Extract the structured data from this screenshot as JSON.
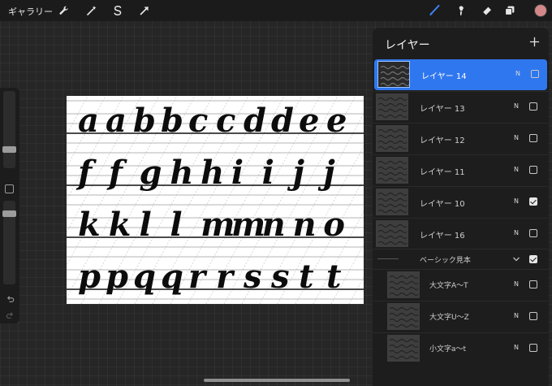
{
  "topbar": {
    "gallery_label": "ギャラリー",
    "tools": [
      {
        "name": "wrench-icon"
      },
      {
        "name": "magic-wand-icon"
      },
      {
        "name": "selection-s-icon"
      },
      {
        "name": "transform-arrow-icon"
      }
    ],
    "right_tools": [
      {
        "name": "brush-icon",
        "active": true
      },
      {
        "name": "smudge-icon"
      },
      {
        "name": "eraser-icon"
      },
      {
        "name": "layers-icon"
      }
    ],
    "active_color": "#d28888",
    "accent_color": "#2f77ee"
  },
  "canvas": {
    "rows": [
      "a a b b c c d d e e",
      "f f g h h i i j j",
      "k k l l m m n n o",
      "p p q q r r s s t t"
    ]
  },
  "layers": {
    "title": "レイヤー",
    "items": [
      {
        "name": "レイヤー 14",
        "blend": "N",
        "visible": false,
        "selected": true
      },
      {
        "name": "レイヤー 13",
        "blend": "N",
        "visible": false,
        "selected": false
      },
      {
        "name": "レイヤー 12",
        "blend": "N",
        "visible": false,
        "selected": false
      },
      {
        "name": "レイヤー 11",
        "blend": "N",
        "visible": false,
        "selected": false
      },
      {
        "name": "レイヤー 10",
        "blend": "N",
        "visible": true,
        "selected": false
      },
      {
        "name": "レイヤー 16",
        "blend": "N",
        "visible": false,
        "selected": false
      }
    ],
    "group": {
      "name": "ベーシック見本",
      "visible": true,
      "children": [
        {
          "name": "大文字A～T",
          "blend": "N",
          "visible": false
        },
        {
          "name": "大文字U～Z",
          "blend": "N",
          "visible": false
        },
        {
          "name": "小文字a～t",
          "blend": "N",
          "visible": false
        }
      ]
    }
  }
}
